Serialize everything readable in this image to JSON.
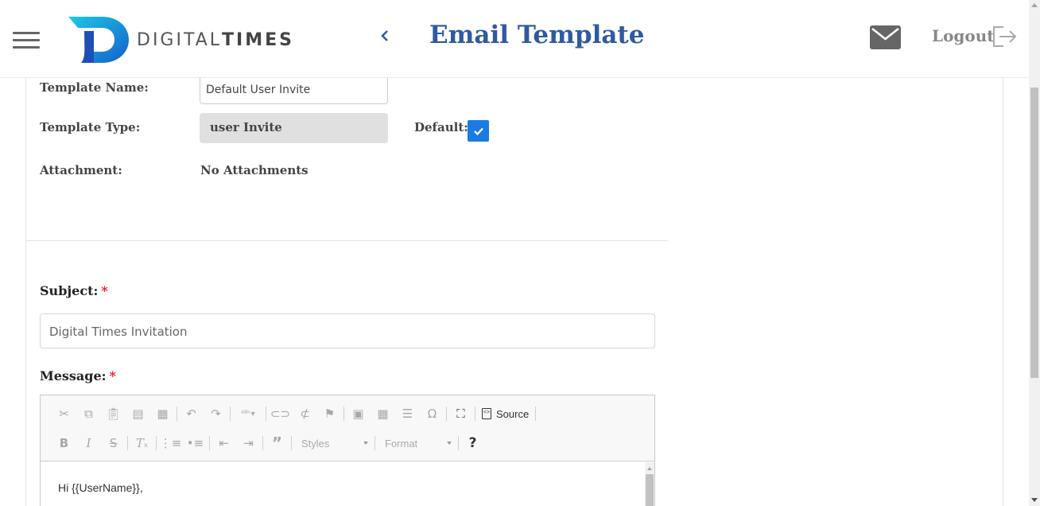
{
  "header": {
    "brand_light": "DIGITAL",
    "brand_bold": "TIMES",
    "back_icon": "chevron-left-icon",
    "title": "Email Template",
    "logout_label": "Logout",
    "accent_color": "#2f5aa0"
  },
  "form": {
    "template_name_label": "Template Name:",
    "template_name_value": "Default User Invite",
    "template_type_label": "Template Type:",
    "template_type_value": "user Invite",
    "default_label": "Default:",
    "default_checked": true,
    "attachment_label": "Attachment:",
    "attachment_value": "No Attachments",
    "subject_label": "Subject:",
    "subject_value": "Digital Times Invitation",
    "message_label": "Message:",
    "required_mark": "*"
  },
  "editor": {
    "source_label": "Source",
    "styles_label": "Styles",
    "format_label": "Format",
    "help_label": "?",
    "body_text": "Hi {{UserName}},"
  }
}
